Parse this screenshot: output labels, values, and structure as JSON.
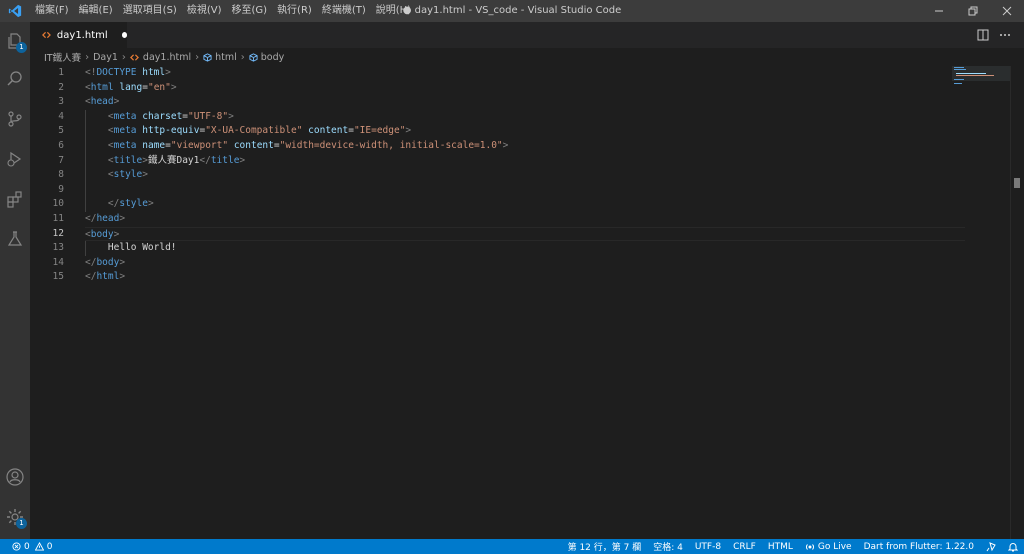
{
  "window": {
    "title": "● day1.html - VS_code - Visual Studio Code",
    "menu": [
      "檔案(F)",
      "編輯(E)",
      "選取項目(S)",
      "檢視(V)",
      "移至(G)",
      "執行(R)",
      "終端機(T)",
      "說明(H)"
    ]
  },
  "activity": {
    "explorer_badge": "1",
    "settings_badge": "1"
  },
  "tab": {
    "label": "day1.html"
  },
  "breadcrumb": [
    "IT鐵人賽",
    "Day1",
    "day1.html",
    "html",
    "body"
  ],
  "editor": {
    "line_numbers": [
      "1",
      "2",
      "3",
      "4",
      "5",
      "6",
      "7",
      "8",
      "9",
      "10",
      "11",
      "12",
      "13",
      "14",
      "15"
    ],
    "active_line": 12,
    "lines": [
      [
        {
          "c": "p",
          "t": "<!"
        },
        {
          "c": "t",
          "t": "DOCTYPE"
        },
        {
          "c": "txt",
          "t": " "
        },
        {
          "c": "a",
          "t": "html"
        },
        {
          "c": "p",
          "t": ">"
        }
      ],
      [
        {
          "c": "p",
          "t": "<"
        },
        {
          "c": "t",
          "t": "html"
        },
        {
          "c": "txt",
          "t": " "
        },
        {
          "c": "a",
          "t": "lang"
        },
        {
          "c": "txt",
          "t": "="
        },
        {
          "c": "s",
          "t": "\"en\""
        },
        {
          "c": "p",
          "t": ">"
        }
      ],
      [
        {
          "c": "p",
          "t": "<"
        },
        {
          "c": "t",
          "t": "head"
        },
        {
          "c": "p",
          "t": ">"
        }
      ],
      [
        {
          "c": "txt",
          "t": "    "
        },
        {
          "c": "p",
          "t": "<"
        },
        {
          "c": "t",
          "t": "meta"
        },
        {
          "c": "txt",
          "t": " "
        },
        {
          "c": "a",
          "t": "charset"
        },
        {
          "c": "txt",
          "t": "="
        },
        {
          "c": "s",
          "t": "\"UTF-8\""
        },
        {
          "c": "p",
          "t": ">"
        }
      ],
      [
        {
          "c": "txt",
          "t": "    "
        },
        {
          "c": "p",
          "t": "<"
        },
        {
          "c": "t",
          "t": "meta"
        },
        {
          "c": "txt",
          "t": " "
        },
        {
          "c": "a",
          "t": "http-equiv"
        },
        {
          "c": "txt",
          "t": "="
        },
        {
          "c": "s",
          "t": "\"X-UA-Compatible\""
        },
        {
          "c": "txt",
          "t": " "
        },
        {
          "c": "a",
          "t": "content"
        },
        {
          "c": "txt",
          "t": "="
        },
        {
          "c": "s",
          "t": "\"IE=edge\""
        },
        {
          "c": "p",
          "t": ">"
        }
      ],
      [
        {
          "c": "txt",
          "t": "    "
        },
        {
          "c": "p",
          "t": "<"
        },
        {
          "c": "t",
          "t": "meta"
        },
        {
          "c": "txt",
          "t": " "
        },
        {
          "c": "a",
          "t": "name"
        },
        {
          "c": "txt",
          "t": "="
        },
        {
          "c": "s",
          "t": "\"viewport\""
        },
        {
          "c": "txt",
          "t": " "
        },
        {
          "c": "a",
          "t": "content"
        },
        {
          "c": "txt",
          "t": "="
        },
        {
          "c": "s",
          "t": "\"width=device-width, initial-scale=1.0\""
        },
        {
          "c": "p",
          "t": ">"
        }
      ],
      [
        {
          "c": "txt",
          "t": "    "
        },
        {
          "c": "p",
          "t": "<"
        },
        {
          "c": "t",
          "t": "title"
        },
        {
          "c": "p",
          "t": ">"
        },
        {
          "c": "txt",
          "t": "鐵人賽Day1"
        },
        {
          "c": "p",
          "t": "</"
        },
        {
          "c": "t",
          "t": "title"
        },
        {
          "c": "p",
          "t": ">"
        }
      ],
      [
        {
          "c": "txt",
          "t": "    "
        },
        {
          "c": "p",
          "t": "<"
        },
        {
          "c": "t",
          "t": "style"
        },
        {
          "c": "p",
          "t": ">"
        }
      ],
      [],
      [
        {
          "c": "txt",
          "t": "    "
        },
        {
          "c": "p",
          "t": "</"
        },
        {
          "c": "t",
          "t": "style"
        },
        {
          "c": "p",
          "t": ">"
        }
      ],
      [
        {
          "c": "p",
          "t": "</"
        },
        {
          "c": "t",
          "t": "head"
        },
        {
          "c": "p",
          "t": ">"
        }
      ],
      [
        {
          "c": "p",
          "t": "<"
        },
        {
          "c": "t",
          "t": "body"
        },
        {
          "c": "p",
          "t": ">"
        }
      ],
      [
        {
          "c": "txt",
          "t": "    Hello World!"
        }
      ],
      [
        {
          "c": "p",
          "t": "</"
        },
        {
          "c": "t",
          "t": "body"
        },
        {
          "c": "p",
          "t": ">"
        }
      ],
      [
        {
          "c": "p",
          "t": "</"
        },
        {
          "c": "t",
          "t": "html"
        },
        {
          "c": "p",
          "t": ">"
        }
      ]
    ]
  },
  "status": {
    "errors": "0",
    "warnings": "0",
    "position": "第 12 行，第 7 欄",
    "spaces": "空格: 4",
    "encoding": "UTF-8",
    "eol": "CRLF",
    "language": "HTML",
    "go_live": "Go Live",
    "flutter": "Dart from Flutter: 1.22.0"
  },
  "colors": {
    "tag": "#569cd6",
    "attribute": "#9cdcfe",
    "string": "#ce9178",
    "punctuation": "#808080",
    "statusbar": "#007acc",
    "titlebar": "#3c3c3c",
    "activitybar": "#333333",
    "editor_bg": "#1e1e1e"
  }
}
